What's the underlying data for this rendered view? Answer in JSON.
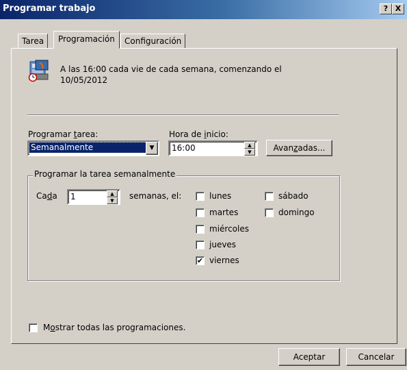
{
  "window": {
    "title": "Programar trabajo",
    "help_btn": "?",
    "close_btn": "X"
  },
  "tabs": [
    {
      "label": "Tarea",
      "active": false
    },
    {
      "label": "Programación",
      "active": true
    },
    {
      "label": "Configuración",
      "active": false
    }
  ],
  "summary": {
    "line1": "A las 16:00 cada vie de cada semana, comenzando el",
    "line2": "10/05/2012"
  },
  "schedule": {
    "label_pre": "Programar ",
    "label_ul": "t",
    "label_post": "area:",
    "value": "Semanalmente"
  },
  "start_time": {
    "label_pre": "Hora de ",
    "label_ul": "i",
    "label_post": "nicio:",
    "value": "16:00"
  },
  "advanced_btn": {
    "pre": "Avan",
    "ul": "z",
    "post": "adas..."
  },
  "weekly_group": {
    "legend": "Programar la tarea semanalmente",
    "every_pre": "Ca",
    "every_ul": "d",
    "every_post": "a",
    "every_value": "1",
    "weeks_label": "semanas, el:",
    "days": [
      {
        "label": "lunes",
        "checked": false
      },
      {
        "label": "martes",
        "checked": false
      },
      {
        "label": "miércoles",
        "checked": false
      },
      {
        "label": "jueves",
        "checked": false
      },
      {
        "label": "viernes",
        "checked": true
      },
      {
        "label": "sábado",
        "checked": false
      },
      {
        "label": "domingo",
        "checked": false
      }
    ]
  },
  "show_all": {
    "pre": "M",
    "ul": "o",
    "post": "strar todas las programaciones.",
    "checked": false
  },
  "footer": {
    "ok": "Aceptar",
    "cancel": "Cancelar"
  },
  "icons": {
    "task": "scheduled-task-icon",
    "check": "✔",
    "dropdown": "▼",
    "spin_up": "▲",
    "spin_down": "▼"
  }
}
